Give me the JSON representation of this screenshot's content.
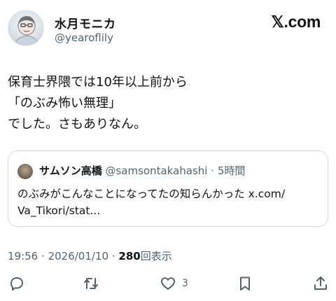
{
  "author": {
    "display_name": "水月モニカ",
    "handle": "@yearoflily",
    "avatar_icon": "user-avatar"
  },
  "brand": {
    "label": "𝕏.com",
    "icon": "x-logo"
  },
  "tweet": {
    "lines": [
      "保育士界隈では10年以上前から",
      "「のぶみ怖い無理」",
      "でした。さもありなん。"
    ]
  },
  "quote": {
    "display_name": "サムソン高橋",
    "handle": "@samsontakahashi",
    "separator": "·",
    "time": "5時間",
    "lines": [
      "のぶみがこんなことになってたの知らんかった x.com/",
      "Va_Tikori/stat..."
    ]
  },
  "meta": {
    "time": "19:56",
    "sep": "·",
    "date": "2026/01/10",
    "sep2": "·",
    "views_count": "280",
    "views_label": "回表示"
  },
  "actions": {
    "reply_icon": "reply-icon",
    "retweet_icon": "retweet-icon",
    "like_icon": "heart-icon",
    "like_count": "3",
    "bookmark_icon": "bookmark-icon",
    "share_icon": "share-icon"
  },
  "colors": {
    "text": "#0f1419",
    "muted": "#536471",
    "border": "#cfd9de"
  }
}
